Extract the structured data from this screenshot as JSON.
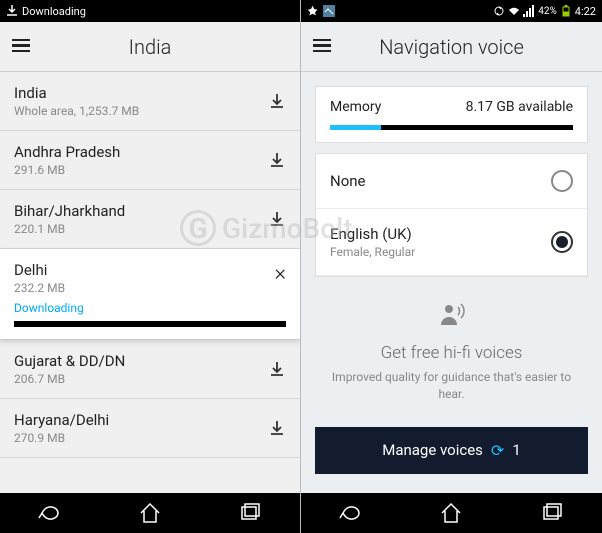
{
  "left": {
    "status": "Downloading",
    "title": "India",
    "items": [
      {
        "name": "India",
        "sub": "Whole area, 1,253.7 MB"
      },
      {
        "name": "Andhra Pradesh",
        "sub": "291.6 MB"
      },
      {
        "name": "Bihar/Jharkhand",
        "sub": "220.1 MB"
      }
    ],
    "active": {
      "name": "Delhi",
      "sub": "232.2 MB",
      "status": "Downloading"
    },
    "items2": [
      {
        "name": "Gujarat & DD/DN",
        "sub": "206.7 MB"
      },
      {
        "name": "Haryana/Delhi",
        "sub": "270.9 MB"
      }
    ]
  },
  "right": {
    "time": "4:22",
    "battery": "42%",
    "title": "Navigation voice",
    "memory_label": "Memory",
    "memory_value": "8.17 GB available",
    "voices": [
      {
        "name": "None",
        "sub": "",
        "checked": false
      },
      {
        "name": "English (UK)",
        "sub": "Female, Regular",
        "checked": true
      }
    ],
    "promo_title": "Get free hi-fi voices",
    "promo_desc": "Improved quality for guidance that's easier to hear.",
    "manage_label": "Manage voices",
    "manage_count": "1"
  },
  "watermark": "GizmoBolt"
}
